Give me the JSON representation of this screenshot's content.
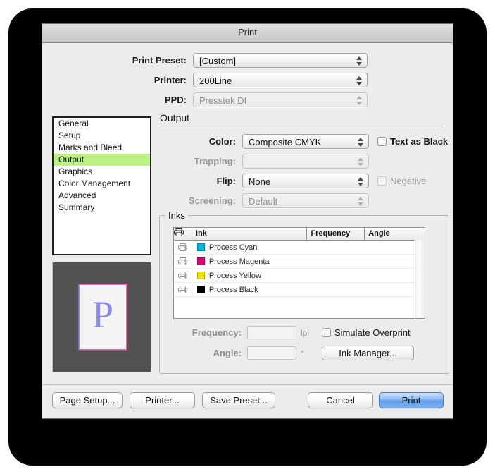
{
  "window": {
    "title": "Print"
  },
  "top_fields": [
    {
      "label": "Print Preset:",
      "value": "[Custom]",
      "enabled": true
    },
    {
      "label": "Printer:",
      "value": "200Line",
      "enabled": true
    },
    {
      "label": "PPD:",
      "value": "Presstek DI",
      "enabled": false
    }
  ],
  "sidebar": {
    "items": [
      {
        "label": "General",
        "selected": false
      },
      {
        "label": "Setup",
        "selected": false
      },
      {
        "label": "Marks and Bleed",
        "selected": false
      },
      {
        "label": "Output",
        "selected": true
      },
      {
        "label": "Graphics",
        "selected": false
      },
      {
        "label": "Color Management",
        "selected": false
      },
      {
        "label": "Advanced",
        "selected": false
      },
      {
        "label": "Summary",
        "selected": false
      }
    ],
    "highlight_color": "#bdf186"
  },
  "preview": {
    "letter": "P",
    "letter_color": "#8b8bf0",
    "page_color": "#f4f4f4",
    "background_color": "#525252",
    "trim_border_color": "#c54a86"
  },
  "output": {
    "section_title": "Output",
    "rows": [
      {
        "label": "Color:",
        "value": "Composite CMYK",
        "enabled": true
      },
      {
        "label": "Trapping:",
        "value": "",
        "enabled": false
      },
      {
        "label": "Flip:",
        "value": "None",
        "enabled": true
      },
      {
        "label": "Screening:",
        "value": "Default",
        "enabled": false
      }
    ],
    "checkboxes": [
      {
        "label": "Text as Black",
        "checked": false,
        "enabled": true
      },
      {
        "label": "Negative",
        "checked": false,
        "enabled": false
      }
    ]
  },
  "inks": {
    "legend": "Inks",
    "columns": [
      "",
      "Ink",
      "Frequency",
      "Angle"
    ],
    "rows": [
      {
        "name": "Process Cyan",
        "color": "#00b3e3",
        "frequency": "",
        "angle": ""
      },
      {
        "name": "Process Magenta",
        "color": "#e0007a",
        "frequency": "",
        "angle": ""
      },
      {
        "name": "Process Yellow",
        "color": "#f5e400",
        "frequency": "",
        "angle": ""
      },
      {
        "name": "Process Black",
        "color": "#000000",
        "frequency": "",
        "angle": ""
      }
    ],
    "frequency": {
      "label": "Frequency:",
      "value": "",
      "unit": "lpi",
      "enabled": false
    },
    "angle": {
      "label": "Angle:",
      "value": "",
      "unit": "°",
      "enabled": false
    },
    "simulate_overprint": {
      "label": "Simulate Overprint",
      "checked": false,
      "enabled": true
    },
    "ink_manager_button": "Ink Manager..."
  },
  "buttons": {
    "page_setup": "Page Setup...",
    "printer": "Printer...",
    "save_preset": "Save Preset...",
    "cancel": "Cancel",
    "print": "Print"
  }
}
